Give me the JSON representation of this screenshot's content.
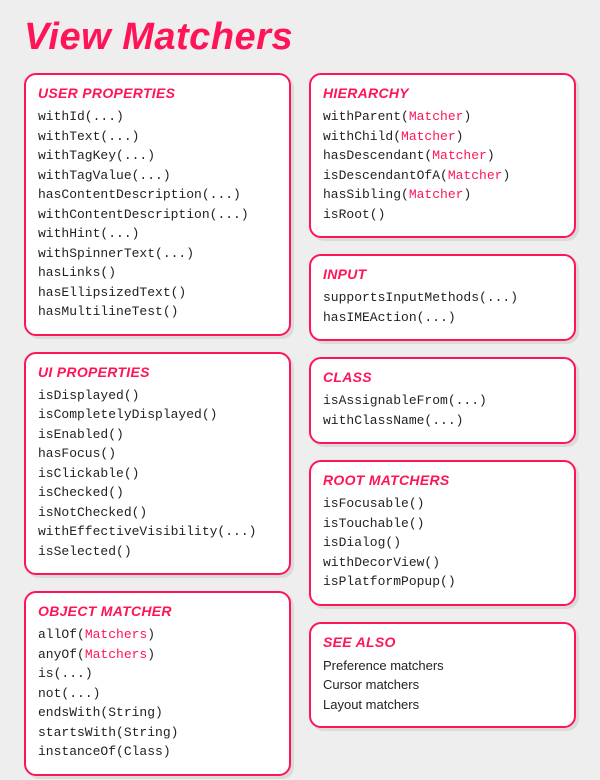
{
  "title": "View Matchers",
  "columns": [
    [
      {
        "id": "user-properties",
        "title": "USER PROPERTIES",
        "mono": true,
        "items": [
          {
            "parts": [
              "withId(",
              "...",
              ")"
            ]
          },
          {
            "parts": [
              "withText(",
              "...",
              ")"
            ]
          },
          {
            "parts": [
              "withTagKey(",
              "...",
              ")"
            ]
          },
          {
            "parts": [
              "withTagValue(",
              "...",
              ")"
            ]
          },
          {
            "parts": [
              "hasContentDescription(",
              "...",
              ")"
            ]
          },
          {
            "parts": [
              "withContentDescription(",
              "...",
              ")"
            ]
          },
          {
            "parts": [
              "withHint(",
              "...",
              ")"
            ]
          },
          {
            "parts": [
              "withSpinnerText(",
              "...",
              ")"
            ]
          },
          {
            "parts": [
              "hasLinks()"
            ]
          },
          {
            "parts": [
              "hasEllipsizedText()"
            ]
          },
          {
            "parts": [
              "hasMultilineTest()"
            ]
          }
        ]
      },
      {
        "id": "ui-properties",
        "title": "UI PROPERTIES",
        "mono": true,
        "items": [
          {
            "parts": [
              "isDisplayed()"
            ]
          },
          {
            "parts": [
              "isCompletelyDisplayed()"
            ]
          },
          {
            "parts": [
              "isEnabled()"
            ]
          },
          {
            "parts": [
              "hasFocus()"
            ]
          },
          {
            "parts": [
              "isClickable()"
            ]
          },
          {
            "parts": [
              "isChecked()"
            ]
          },
          {
            "parts": [
              "isNotChecked()"
            ]
          },
          {
            "parts": [
              "withEffectiveVisibility(",
              "...",
              ")"
            ]
          },
          {
            "parts": [
              "isSelected()"
            ]
          }
        ]
      },
      {
        "id": "object-matcher",
        "title": "OBJECT MATCHER",
        "mono": true,
        "items": [
          {
            "parts": [
              "allOf(",
              [
                "arg",
                "Matchers"
              ],
              ")"
            ]
          },
          {
            "parts": [
              "anyOf(",
              [
                "arg",
                "Matchers"
              ],
              ")"
            ]
          },
          {
            "parts": [
              "is(",
              "...",
              ")"
            ]
          },
          {
            "parts": [
              "not(",
              "...",
              ")"
            ]
          },
          {
            "parts": [
              "endsWith(",
              "String",
              ")"
            ]
          },
          {
            "parts": [
              "startsWith(",
              "String",
              ")"
            ]
          },
          {
            "parts": [
              "instanceOf(",
              "Class",
              ")"
            ]
          }
        ]
      }
    ],
    [
      {
        "id": "hierarchy",
        "title": "HIERARCHY",
        "mono": true,
        "items": [
          {
            "parts": [
              "withParent(",
              [
                "arg",
                "Matcher"
              ],
              ")"
            ]
          },
          {
            "parts": [
              "withChild(",
              [
                "arg",
                "Matcher"
              ],
              ")"
            ]
          },
          {
            "parts": [
              "hasDescendant(",
              [
                "arg",
                "Matcher"
              ],
              ")"
            ]
          },
          {
            "parts": [
              "isDescendantOfA(",
              [
                "arg",
                "Matcher"
              ],
              ")"
            ]
          },
          {
            "parts": [
              "hasSibling(",
              [
                "arg",
                "Matcher"
              ],
              ")"
            ]
          },
          {
            "parts": [
              "isRoot()"
            ]
          }
        ]
      },
      {
        "id": "input",
        "title": "INPUT",
        "mono": true,
        "items": [
          {
            "parts": [
              "supportsInputMethods(",
              "...",
              ")"
            ]
          },
          {
            "parts": [
              "hasIMEAction(",
              "...",
              ")"
            ]
          }
        ]
      },
      {
        "id": "class",
        "title": "CLASS",
        "mono": true,
        "items": [
          {
            "parts": [
              "isAssignableFrom(",
              "...",
              ")"
            ]
          },
          {
            "parts": [
              "withClassName(",
              "...",
              ")"
            ]
          }
        ]
      },
      {
        "id": "root-matchers",
        "title": "ROOT MATCHERS",
        "mono": true,
        "items": [
          {
            "parts": [
              "isFocusable()"
            ]
          },
          {
            "parts": [
              "isTouchable()"
            ]
          },
          {
            "parts": [
              "isDialog()"
            ]
          },
          {
            "parts": [
              "withDecorView()"
            ]
          },
          {
            "parts": [
              "isPlatformPopup()"
            ]
          }
        ]
      },
      {
        "id": "see-also",
        "title": "SEE ALSO",
        "mono": false,
        "items": [
          {
            "parts": [
              "Preference matchers"
            ]
          },
          {
            "parts": [
              "Cursor matchers"
            ]
          },
          {
            "parts": [
              "Layout matchers"
            ]
          }
        ]
      }
    ]
  ]
}
